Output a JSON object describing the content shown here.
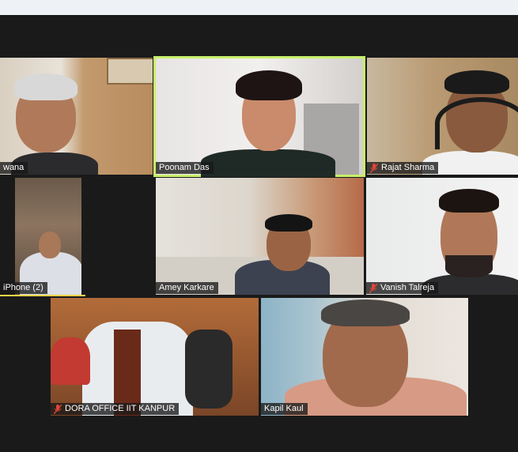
{
  "participants": [
    {
      "name": "wana",
      "muted": false
    },
    {
      "name": "Poonam Das",
      "muted": false,
      "active_speaker": true
    },
    {
      "name": "Rajat Sharma",
      "muted": true
    },
    {
      "name": "iPhone (2)",
      "muted": false
    },
    {
      "name": "Amey Karkare",
      "muted": false
    },
    {
      "name": "Vanish Talreja",
      "muted": true
    },
    {
      "name": "DORA OFFICE IIT KANPUR",
      "muted": true
    },
    {
      "name": "Kapil Kaul",
      "muted": false
    }
  ],
  "colors": {
    "active_speaker_border": "#c9f06a",
    "muted_icon": "#e0463a",
    "background": "#1a1a1a"
  },
  "icons": {
    "muted": "mic-off-icon"
  }
}
